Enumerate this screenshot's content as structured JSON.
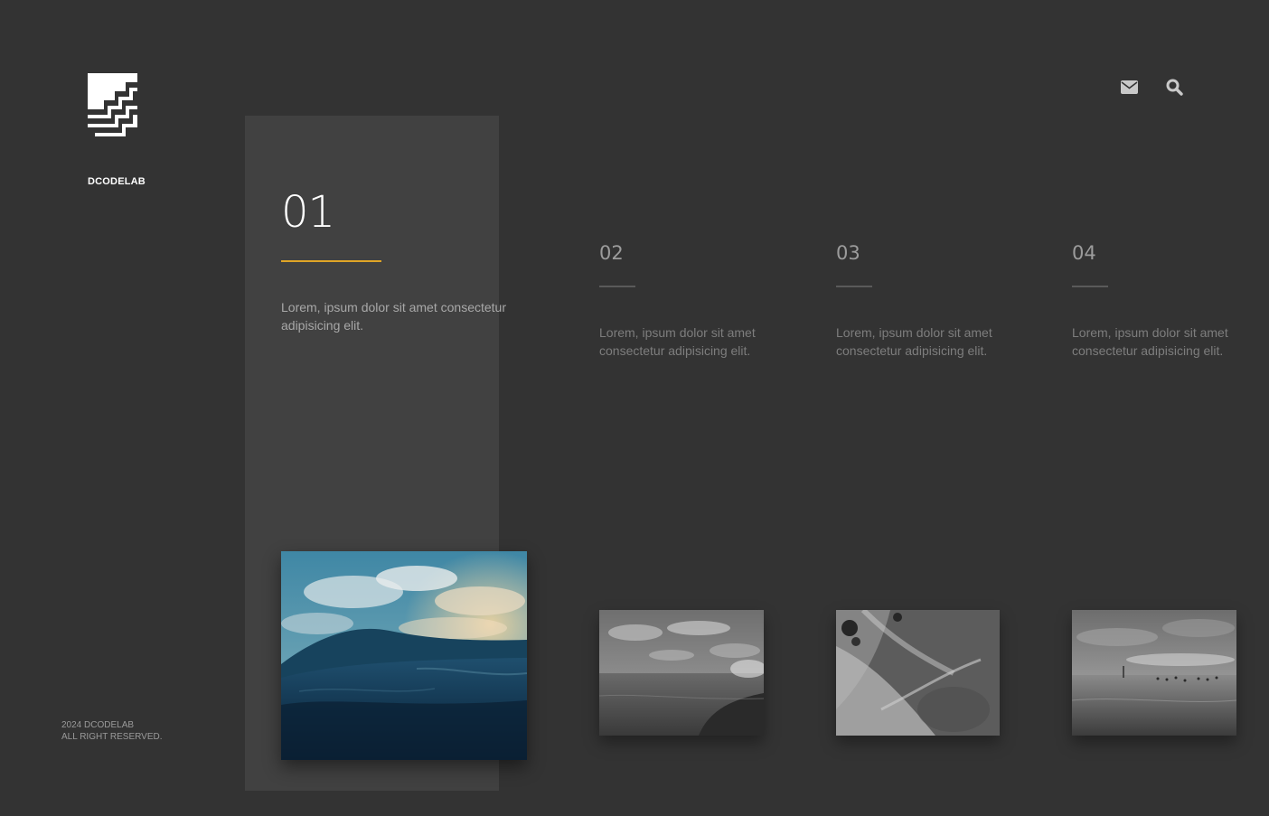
{
  "brand": {
    "logo_icon": "stair-logo-icon",
    "name": "DCODELAB"
  },
  "footer": {
    "line1": "2024 DCODELAB",
    "line2": "ALL RIGHT RESERVED."
  },
  "top_icons": [
    {
      "name": "mail-icon"
    },
    {
      "name": "search-icon"
    }
  ],
  "colors": {
    "background": "#333333",
    "panel": "#414141",
    "accent": "#e0a526"
  },
  "active_slide": {
    "number": "01",
    "description": "Lorem, ipsum dolor sit amet consectetur adipisicing elit."
  },
  "slides": [
    {
      "number": "02",
      "description": "Lorem, ipsum dolor sit amet consectetur adipisicing elit."
    },
    {
      "number": "03",
      "description": "Lorem, ipsum dolor sit amet consectetur adipisicing elit."
    },
    {
      "number": "04",
      "description": "Lorem, ipsum dolor sit amet consectetur adipisicing elit."
    }
  ]
}
